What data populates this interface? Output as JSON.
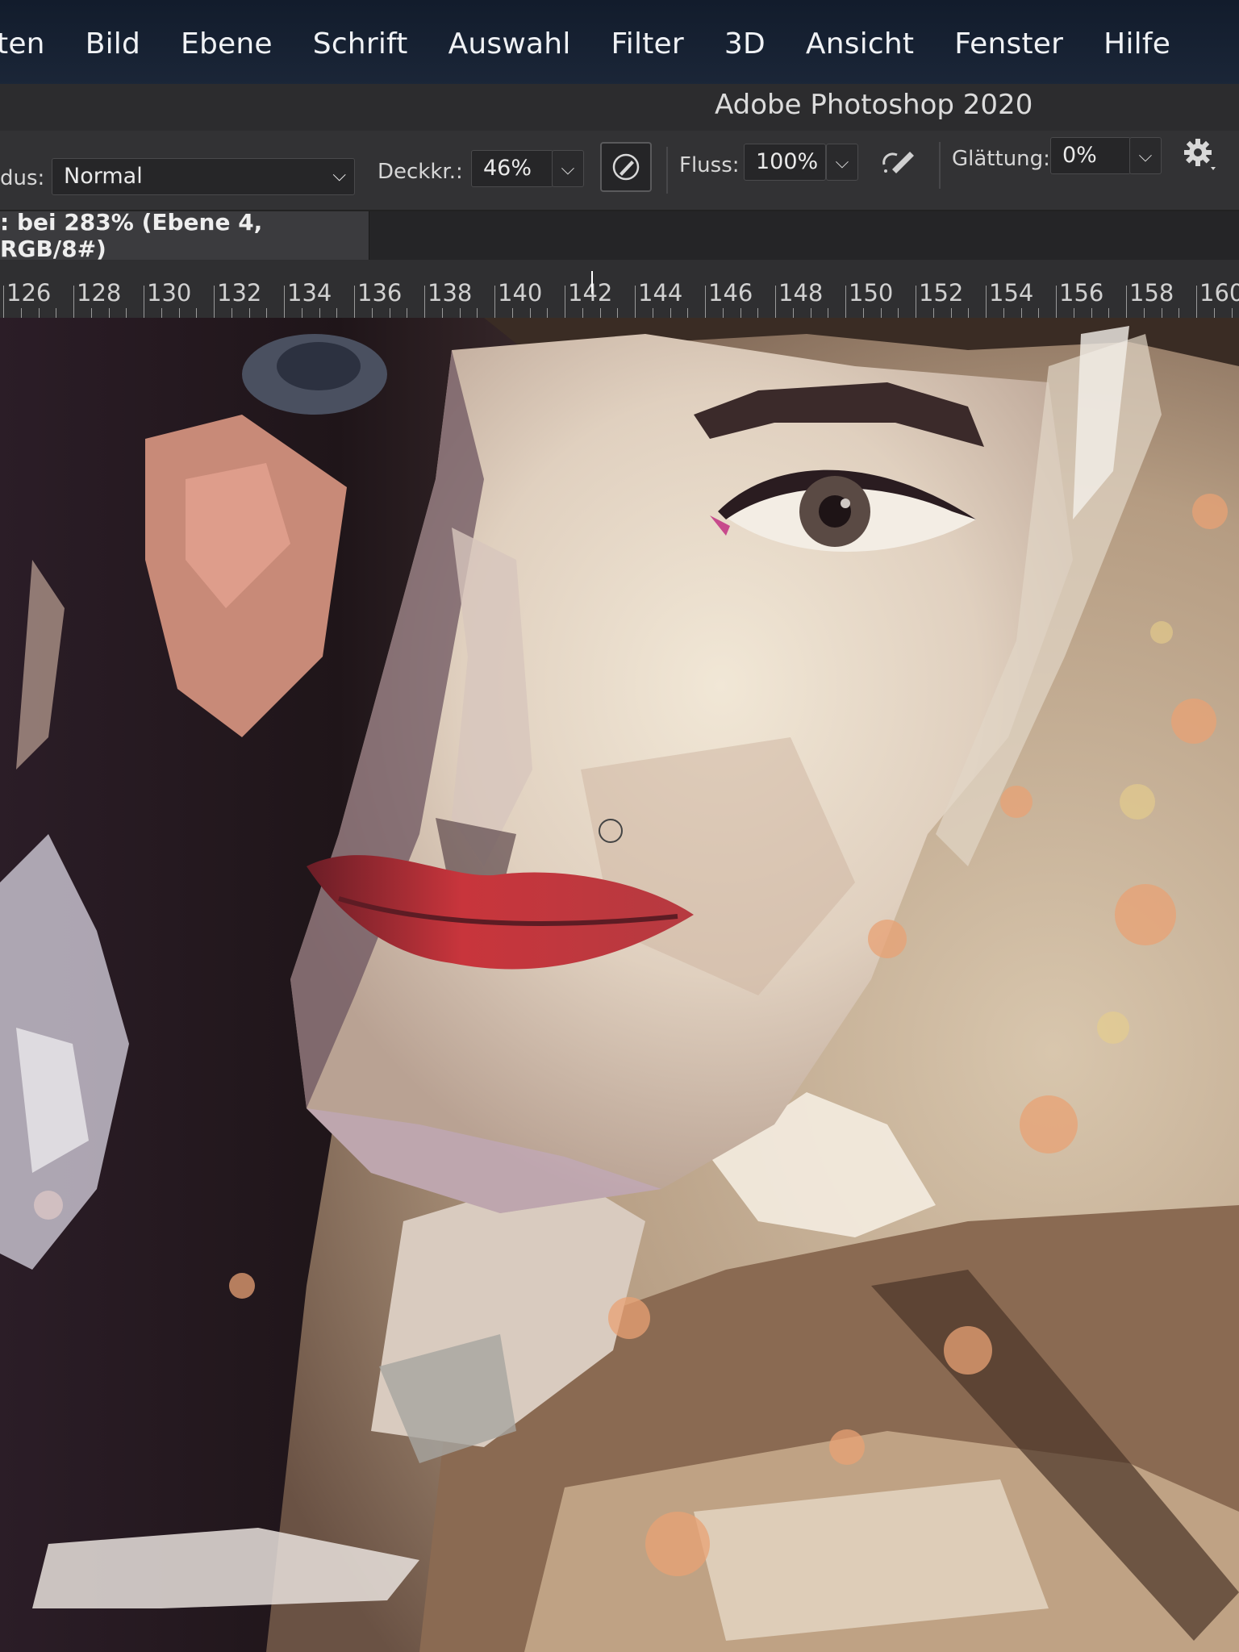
{
  "menu": {
    "items": [
      "ten",
      "Bild",
      "Ebene",
      "Schrift",
      "Auswahl",
      "Filter",
      "3D",
      "Ansicht",
      "Fenster",
      "Hilfe"
    ]
  },
  "window": {
    "title": "Adobe Photoshop 2020"
  },
  "options": {
    "mode_label": "dus:",
    "mode_value": "Normal",
    "opacity_label": "Deckkr.:",
    "opacity_value": "46%",
    "flow_label": "Fluss:",
    "flow_value": "100%",
    "smoothing_label": "Glättung:",
    "smoothing_value": "0%"
  },
  "document": {
    "tab_label": ": bei 283% (Ebene 4, RGB/8#)"
  },
  "ruler": {
    "labels": [
      "126",
      "128",
      "130",
      "132",
      "134",
      "136",
      "138",
      "140",
      "142",
      "144",
      "146",
      "148",
      "150",
      "152",
      "154",
      "156",
      "158",
      "160"
    ]
  },
  "icons": {
    "brush_pressure": "pressure-brush-icon",
    "airbrush": "airbrush-icon",
    "settings": "gear-icon"
  },
  "colors": {
    "menubar": "#172235",
    "panel": "#323234",
    "accent_lip": "#c8353c",
    "skin_light": "#e9dcc9",
    "background_warm": "#c9b49a"
  }
}
